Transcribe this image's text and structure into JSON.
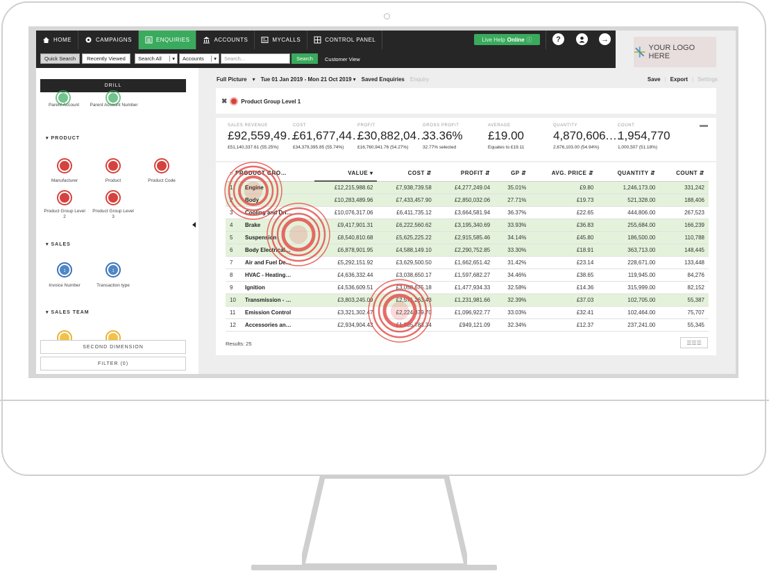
{
  "nav": {
    "items": [
      {
        "label": "HOME",
        "icon": "home-icon"
      },
      {
        "label": "CAMPAIGNS",
        "icon": "campaigns-icon"
      },
      {
        "label": "ENQUIRIES",
        "icon": "enquiries-icon"
      },
      {
        "label": "ACCOUNTS",
        "icon": "bank-icon"
      },
      {
        "label": "MYCALLS",
        "icon": "calls-icon"
      },
      {
        "label": "CONTROL PANEL",
        "icon": "grid-icon"
      }
    ],
    "live_help": "Live Help",
    "live_help_status": "Online",
    "logo_text": "YOUR LOGO HERE"
  },
  "subnav": {
    "quick_search": "Quick Search",
    "recently_viewed": "Recently Viewed",
    "search_all": "Search All",
    "accounts": "Accounts",
    "search_placeholder": "Search...",
    "search_button": "Search",
    "customer_view": "Customer View"
  },
  "left": {
    "drill": "DRILL",
    "top_items": [
      "Parent Account",
      "Parent Account Number"
    ],
    "product_head": "PRODUCT",
    "product_items": [
      "Manufacturer",
      "Product",
      "Product Code",
      "Product Group Level 2",
      "Product Group Level 3"
    ],
    "sales_head": "SALES",
    "sales_items": [
      "Invoice Number",
      "Transaction type"
    ],
    "sales_team_head": "SALES TEAM",
    "second_dimension": "SECOND DIMENSION",
    "filter": "FILTER (0)"
  },
  "toolbar": {
    "view": "Full Picture",
    "date_range": "Tue 01 Jan 2019 - Mon 21 Oct 2019",
    "saved": "Saved Enquiries",
    "enquiry": "Enquiry",
    "save": "Save",
    "export": "Export",
    "settings": "Settings"
  },
  "filter_chip": "Product Group Level 1",
  "summary": [
    {
      "label": "SALES REVENUE",
      "value": "£92,559,49…",
      "sub": "£51,140,337.61 (55.25%)"
    },
    {
      "label": "COST",
      "value": "£61,677,44…",
      "sub": "£34,379,395.85 (55.74%)"
    },
    {
      "label": "PROFIT",
      "value": "£30,882,04…",
      "sub": "£16,760,941.76 (54.27%)"
    },
    {
      "label": "GROSS PROFIT",
      "value": "33.36%",
      "sub": "32.77% selected"
    },
    {
      "label": "AVERAGE",
      "value": "£19.00",
      "sub": "Equates to £19.11"
    },
    {
      "label": "QUANTITY",
      "value": "4,870,606.…",
      "sub": "2,676,103.00 (54.94%)"
    },
    {
      "label": "COUNT",
      "value": "1,954,770",
      "sub": "1,000,507 (51.18%)"
    }
  ],
  "table": {
    "headers": [
      "PRODUCT GRO…",
      "VALUE",
      "COST",
      "PROFIT",
      "GP",
      "AVG. PRICE",
      "QUANTITY",
      "COUNT"
    ],
    "rows": [
      {
        "n": "1",
        "name": "Engine",
        "value": "£12,215,988.62",
        "cost": "£7,938,739.58",
        "profit": "£4,277,249.04",
        "gp": "35.01%",
        "avg": "£9.80",
        "qty": "1,246,173.00",
        "count": "331,242",
        "hl": true
      },
      {
        "n": "2",
        "name": "Body",
        "value": "£10,283,489.96",
        "cost": "£7,433,457.90",
        "profit": "£2,850,032.06",
        "gp": "27.71%",
        "avg": "£19.73",
        "qty": "521,328.00",
        "count": "188,406",
        "hl": true
      },
      {
        "n": "3",
        "name": "Cooling and Dri…",
        "value": "£10,076,317.06",
        "cost": "£6,411,735.12",
        "profit": "£3,664,581.94",
        "gp": "36.37%",
        "avg": "£22.65",
        "qty": "444,806.00",
        "count": "267,523",
        "hl": false
      },
      {
        "n": "4",
        "name": "Brake",
        "value": "£9,417,901.31",
        "cost": "£6,222,560.62",
        "profit": "£3,195,340.69",
        "gp": "33.93%",
        "avg": "£36.83",
        "qty": "255,684.00",
        "count": "166,239",
        "hl": true
      },
      {
        "n": "5",
        "name": "Suspension",
        "value": "£8,540,810.68",
        "cost": "£5,625,225.22",
        "profit": "£2,915,585.46",
        "gp": "34.14%",
        "avg": "£45.80",
        "qty": "186,500.00",
        "count": "110,788",
        "hl": true
      },
      {
        "n": "6",
        "name": "Body Electrical…",
        "value": "£6,878,901.95",
        "cost": "£4,588,149.10",
        "profit": "£2,290,752.85",
        "gp": "33.30%",
        "avg": "£18.91",
        "qty": "363,713.00",
        "count": "148,445",
        "hl": true
      },
      {
        "n": "7",
        "name": "Air and Fuel De…",
        "value": "£5,292,151.92",
        "cost": "£3,629,500.50",
        "profit": "£1,662,651.42",
        "gp": "31.42%",
        "avg": "£23.14",
        "qty": "228,671.00",
        "count": "133,448",
        "hl": false
      },
      {
        "n": "8",
        "name": "HVAC - Heating…",
        "value": "£4,636,332.44",
        "cost": "£3,038,650.17",
        "profit": "£1,597,682.27",
        "gp": "34.46%",
        "avg": "£38.65",
        "qty": "119,945.00",
        "count": "84,276",
        "hl": false
      },
      {
        "n": "9",
        "name": "Ignition",
        "value": "£4,536,609.51",
        "cost": "£3,058,675.18",
        "profit": "£1,477,934.33",
        "gp": "32.58%",
        "avg": "£14.36",
        "qty": "315,999.00",
        "count": "82,152",
        "hl": false
      },
      {
        "n": "10",
        "name": "Transmission - …",
        "value": "£3,803,245.09",
        "cost": "£2,571,263.43",
        "profit": "£1,231,981.66",
        "gp": "32.39%",
        "avg": "£37.03",
        "qty": "102,705.00",
        "count": "55,387",
        "hl": true
      },
      {
        "n": "11",
        "name": "Emission Control",
        "value": "£3,321,302.47",
        "cost": "£2,224,379.70",
        "profit": "£1,096,922.77",
        "gp": "33.03%",
        "avg": "£32.41",
        "qty": "102,464.00",
        "count": "75,707",
        "hl": false
      },
      {
        "n": "12",
        "name": "Accessories an…",
        "value": "£2,934,904.43",
        "cost": "£1,985,783.34",
        "profit": "£949,121.09",
        "gp": "32.34%",
        "avg": "£12.37",
        "qty": "237,241.00",
        "count": "55,345",
        "hl": false
      }
    ],
    "results": "Results: 25"
  }
}
